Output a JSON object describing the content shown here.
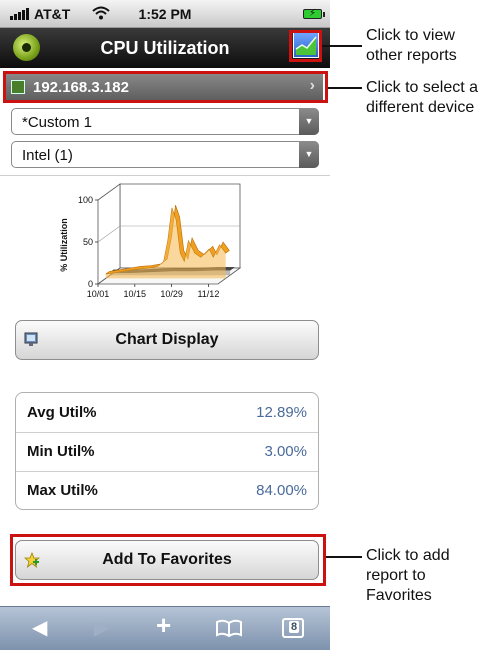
{
  "status_bar": {
    "carrier": "AT&T",
    "time": "1:52 PM"
  },
  "nav": {
    "title": "CPU Utilization"
  },
  "device": {
    "address": "192.168.3.182"
  },
  "selects": {
    "report": "*Custom 1",
    "cpu": "Intel (1)"
  },
  "chart_data": {
    "type": "area",
    "title": "",
    "xlabel": "",
    "ylabel": "% Utilization",
    "ylim": [
      0,
      100
    ],
    "y_ticks": [
      "0",
      "50",
      "100"
    ],
    "x_ticks": [
      "10/01",
      "10/15",
      "10/29",
      "11/12"
    ],
    "grid": true,
    "series": [
      {
        "color": "#f0a020",
        "x": [
          0,
          5,
          10,
          15,
          20,
          25,
          28,
          30,
          32,
          34,
          36,
          38,
          40,
          43,
          46,
          50,
          52,
          55,
          58
        ],
        "values": [
          5,
          7,
          9,
          11,
          12,
          14,
          20,
          45,
          84,
          70,
          30,
          20,
          45,
          30,
          25,
          35,
          25,
          40,
          30
        ]
      },
      {
        "color": "#333333",
        "x": [
          0,
          10,
          20,
          30,
          40,
          50,
          58
        ],
        "values": [
          3,
          3,
          4,
          5,
          5,
          6,
          6
        ]
      }
    ]
  },
  "buttons": {
    "chart_display": "Chart Display",
    "add_favorites": "Add To Favorites"
  },
  "stats": [
    {
      "label": "Avg Util%",
      "value": "12.89%"
    },
    {
      "label": "Min Util%",
      "value": "3.00%"
    },
    {
      "label": "Max Util%",
      "value": "84.00%"
    }
  ],
  "toolbar": {
    "tab_count": "8"
  },
  "callouts": {
    "reports": [
      "Click to view",
      "other reports"
    ],
    "device": [
      "Click to select a",
      "different device"
    ],
    "favorites": [
      "Click to add",
      "report to",
      "Favorites"
    ]
  },
  "colors": {
    "highlight": "#cc1111",
    "navbar": "#1a1a1a",
    "accent_value": "#4a6a9a",
    "chart_orange": "#f0a020"
  }
}
